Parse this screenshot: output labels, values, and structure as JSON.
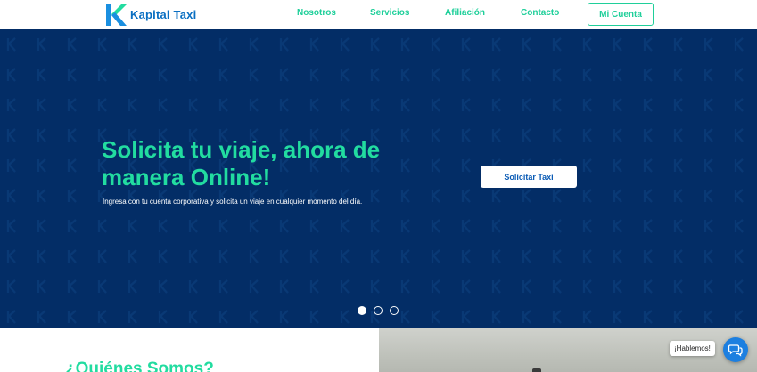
{
  "brand": {
    "name": "Kapital Taxi"
  },
  "nav": {
    "items": [
      {
        "label": "Nosotros"
      },
      {
        "label": "Servicios"
      },
      {
        "label": "Afiliación"
      },
      {
        "label": "Contacto"
      }
    ],
    "account_label": "Mi Cuenta"
  },
  "hero": {
    "title": "Solicita tu viaje, ahora de manera Online!",
    "subtitle": "Ingresa con tu cuenta corporativa y solicita un viaje en cualquier momento del día.",
    "cta_label": "Solicitar Taxi",
    "slides_total": 3,
    "active_slide": 1
  },
  "about": {
    "title": "¿Quiénes Somos?"
  },
  "chat": {
    "label": "¡Hablemos!",
    "icon": "chat-bubbles-icon"
  },
  "colors": {
    "accent": "#22dca0",
    "brand_blue": "#0a6fc2",
    "hero_bg": "#032d66",
    "chat_blue": "#1c7fe0"
  }
}
